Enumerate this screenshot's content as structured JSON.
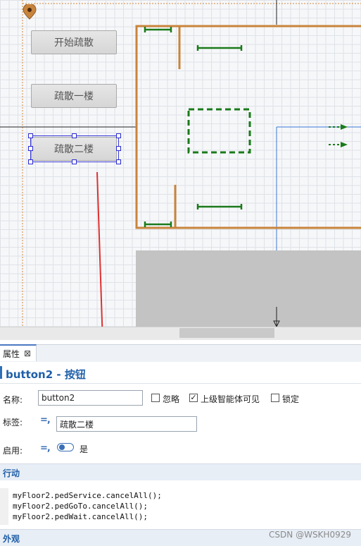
{
  "canvas": {
    "buttons": [
      {
        "label": "开始疏散"
      },
      {
        "label": "疏散一楼"
      },
      {
        "label": "疏散二楼"
      }
    ],
    "colors": {
      "wall": "#c8843c",
      "path": "#1a7a1a",
      "selection": "#2a2ad0",
      "arrow": "#e03030",
      "floor_gray": "#c3c3c3"
    }
  },
  "panel": {
    "tab_label": "属性",
    "tab_close": "⊠",
    "title": "button2 - 按钮",
    "name_label": "名称:",
    "name_value": "button2",
    "ignore_label": "忽略",
    "upper_agent_label": "上级智能体可见",
    "lock_label": "锁定",
    "tag_label": "标签:",
    "tag_value": "疏散二楼",
    "enabled_label": "启用:",
    "enabled_value": "是",
    "action_section": "行动",
    "code_lines": [
      "myFloor2.pedService.cancelAll();",
      "myFloor2.pedGoTo.cancelAll();",
      "myFloor2.pedWait.cancelAll();"
    ],
    "appearance_section": "外观"
  },
  "watermark": "CSDN @WSKH0929"
}
